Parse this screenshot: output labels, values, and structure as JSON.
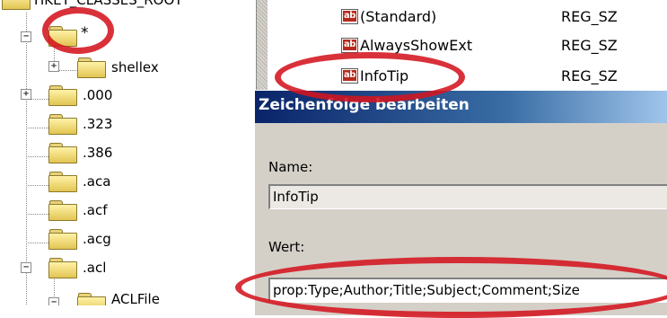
{
  "tree": {
    "root_label": "HKEY_CLASSES_ROOT",
    "items": [
      {
        "label": "*",
        "expander": "−",
        "icon": "folder-icon"
      },
      {
        "label": "shellex",
        "expander": "+",
        "icon": "folder-icon"
      },
      {
        "label": ".000",
        "expander": "+",
        "icon": "folder-icon"
      },
      {
        "label": ".323",
        "expander": "",
        "icon": "folder-icon"
      },
      {
        "label": ".386",
        "expander": "",
        "icon": "folder-icon"
      },
      {
        "label": ".aca",
        "expander": "",
        "icon": "folder-icon"
      },
      {
        "label": ".acf",
        "expander": "",
        "icon": "folder-icon"
      },
      {
        "label": ".acg",
        "expander": "",
        "icon": "folder-icon"
      },
      {
        "label": ".acl",
        "expander": "−",
        "icon": "folder-icon"
      },
      {
        "label": "ACLFile",
        "expander": "−",
        "icon": "folder-icon"
      }
    ]
  },
  "values": {
    "rows": [
      {
        "name": "(Standard)",
        "type": "REG_SZ",
        "icon": "string-value-icon",
        "badge": "ab"
      },
      {
        "name": "AlwaysShowExt",
        "type": "REG_SZ",
        "icon": "string-value-icon",
        "badge": "ab"
      },
      {
        "name": "InfoTip",
        "type": "REG_SZ",
        "icon": "string-value-icon",
        "badge": "ab"
      }
    ]
  },
  "dialog": {
    "title": "Zeichenfolge bearbeiten",
    "name_label": "Name:",
    "name_value": "InfoTip",
    "value_label": "Wert:",
    "value_value": "prop:Type;Author;Title;Subject;Comment;Size"
  },
  "colors": {
    "highlight_ring": "#d4141f",
    "titlebar_start": "#0a246a",
    "titlebar_end": "#a6caf0",
    "dialog_face": "#d4d0c8"
  }
}
